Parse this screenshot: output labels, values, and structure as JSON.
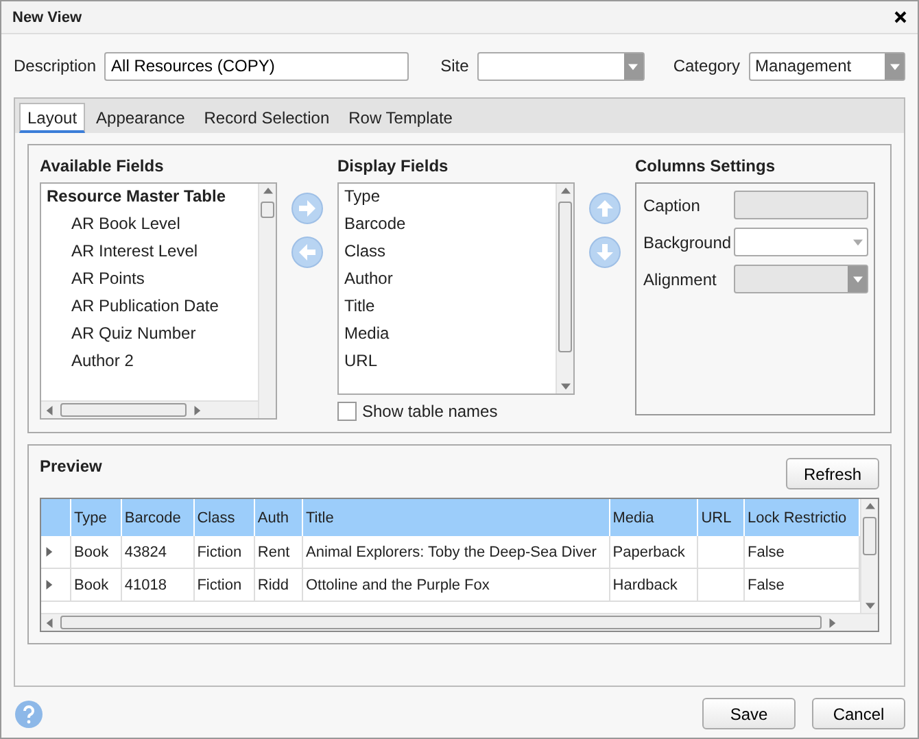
{
  "window": {
    "title": "New View"
  },
  "form": {
    "description": {
      "label": "Description",
      "value": "All Resources (COPY)"
    },
    "site": {
      "label": "Site"
    },
    "category": {
      "label": "Category",
      "value": "Management"
    }
  },
  "tabs": [
    {
      "label": "Layout",
      "selected": true
    },
    {
      "label": "Appearance",
      "selected": false
    },
    {
      "label": "Record Selection",
      "selected": false
    },
    {
      "label": "Row Template",
      "selected": false
    }
  ],
  "available_fields": {
    "title": "Available Fields",
    "group": "Resource Master Table",
    "items": [
      "AR Book Level",
      "AR Interest Level",
      "AR Points",
      "AR Publication Date",
      "AR Quiz Number",
      "Author 2"
    ]
  },
  "display_fields": {
    "title": "Display Fields",
    "items": [
      "Type",
      "Barcode",
      "Class",
      "Author",
      "Title",
      "Media",
      "URL"
    ],
    "show_table_names": {
      "label": "Show table names",
      "checked": false
    }
  },
  "columns_settings": {
    "title": "Columns Settings",
    "fields": [
      {
        "label": "Caption",
        "kind": "text",
        "disabled": true
      },
      {
        "label": "Background",
        "kind": "dropdown",
        "disabled": false
      },
      {
        "label": "Alignment",
        "kind": "dropdown",
        "disabled": true
      }
    ]
  },
  "preview": {
    "title": "Preview",
    "refresh": "Refresh",
    "columns": [
      "Type",
      "Barcode",
      "Class",
      "Auth",
      "Title",
      "Media",
      "URL",
      "Lock Restrictio"
    ],
    "rows": [
      [
        "Book",
        "43824",
        "Fiction",
        "Rent",
        "Animal Explorers: Toby the Deep-Sea Diver",
        "Paperback",
        "",
        "False"
      ],
      [
        "Book",
        "41018",
        "Fiction",
        "Ridd",
        "Ottoline and the Purple Fox",
        "Hardback",
        "",
        "False"
      ]
    ]
  },
  "buttons": [
    "Save",
    "Cancel"
  ]
}
